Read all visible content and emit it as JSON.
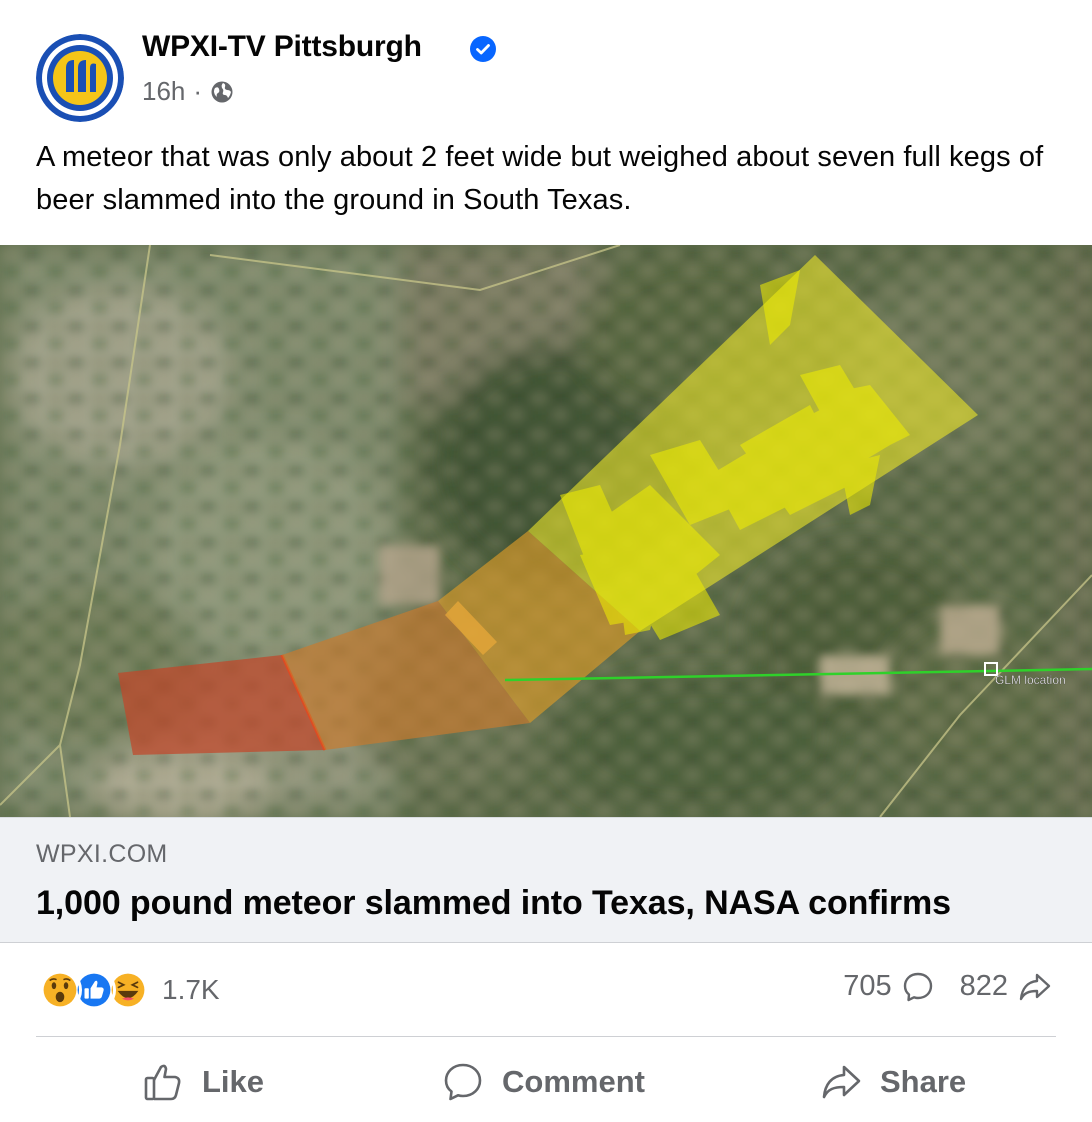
{
  "post": {
    "page_name": "WPXI-TV Pittsburgh",
    "verified": true,
    "time": "16h",
    "separator": "·",
    "privacy_icon": "globe-icon",
    "caption": "A meteor that was only about 2 feet wide but weighed about seven full kegs of beer slammed into the ground in South Texas."
  },
  "image": {
    "description_label": "GLM location"
  },
  "link_preview": {
    "domain": "WPXI.COM",
    "title": "1,000 pound meteor slammed into Texas, NASA confirms"
  },
  "engagement": {
    "reaction_icons": [
      "wow-reaction-icon",
      "like-reaction-icon",
      "haha-reaction-icon"
    ],
    "reaction_count": "1.7K",
    "comment_count": "705",
    "share_count": "822"
  },
  "actions": {
    "like_label": "Like",
    "comment_label": "Comment",
    "share_label": "Share"
  },
  "colors": {
    "brand_blue": "#0866ff",
    "secondary_text": "#65676b",
    "link_bg": "#f0f2f5",
    "logo_yellow": "#f5c518"
  }
}
